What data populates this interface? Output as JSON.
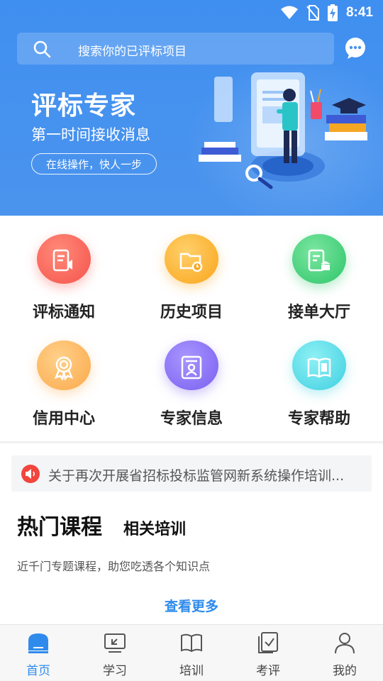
{
  "status_bar": {
    "time": "8:41"
  },
  "search": {
    "placeholder": "搜索你的已评标项目"
  },
  "banner": {
    "title": "评标专家",
    "subtitle": "第一时间接收消息",
    "pill": "在线操作，快人一步"
  },
  "features": [
    {
      "label": "评标通知",
      "icon": "notice-doc-icon",
      "color": "#f5534a"
    },
    {
      "label": "历史项目",
      "icon": "folder-clock-icon",
      "color": "#f9a51c"
    },
    {
      "label": "接单大厅",
      "icon": "doc-bank-icon",
      "color": "#2ec56a"
    },
    {
      "label": "信用中心",
      "icon": "badge-icon",
      "color": "#fba94a"
    },
    {
      "label": "专家信息",
      "icon": "expert-id-icon",
      "color": "#7a5ff0"
    },
    {
      "label": "专家帮助",
      "icon": "book-icon",
      "color": "#3ed0e0"
    }
  ],
  "notice": {
    "text": "关于再次开展省招标投标监管网新系统操作培训..."
  },
  "courses": {
    "heading": "热门课程",
    "tab": "相关培训",
    "description": "近千门专题课程，助您吃透各个知识点",
    "more": "查看更多"
  },
  "nav": [
    {
      "label": "首页",
      "icon": "home-icon",
      "active": true
    },
    {
      "label": "学习",
      "icon": "study-icon",
      "active": false
    },
    {
      "label": "培训",
      "icon": "training-book-icon",
      "active": false
    },
    {
      "label": "考评",
      "icon": "exam-check-icon",
      "active": false
    },
    {
      "label": "我的",
      "icon": "profile-icon",
      "active": false
    }
  ],
  "colors": {
    "primary": "#3f8ff0",
    "accent_blue": "#2e8bec",
    "notice_red": "#f1453d"
  }
}
